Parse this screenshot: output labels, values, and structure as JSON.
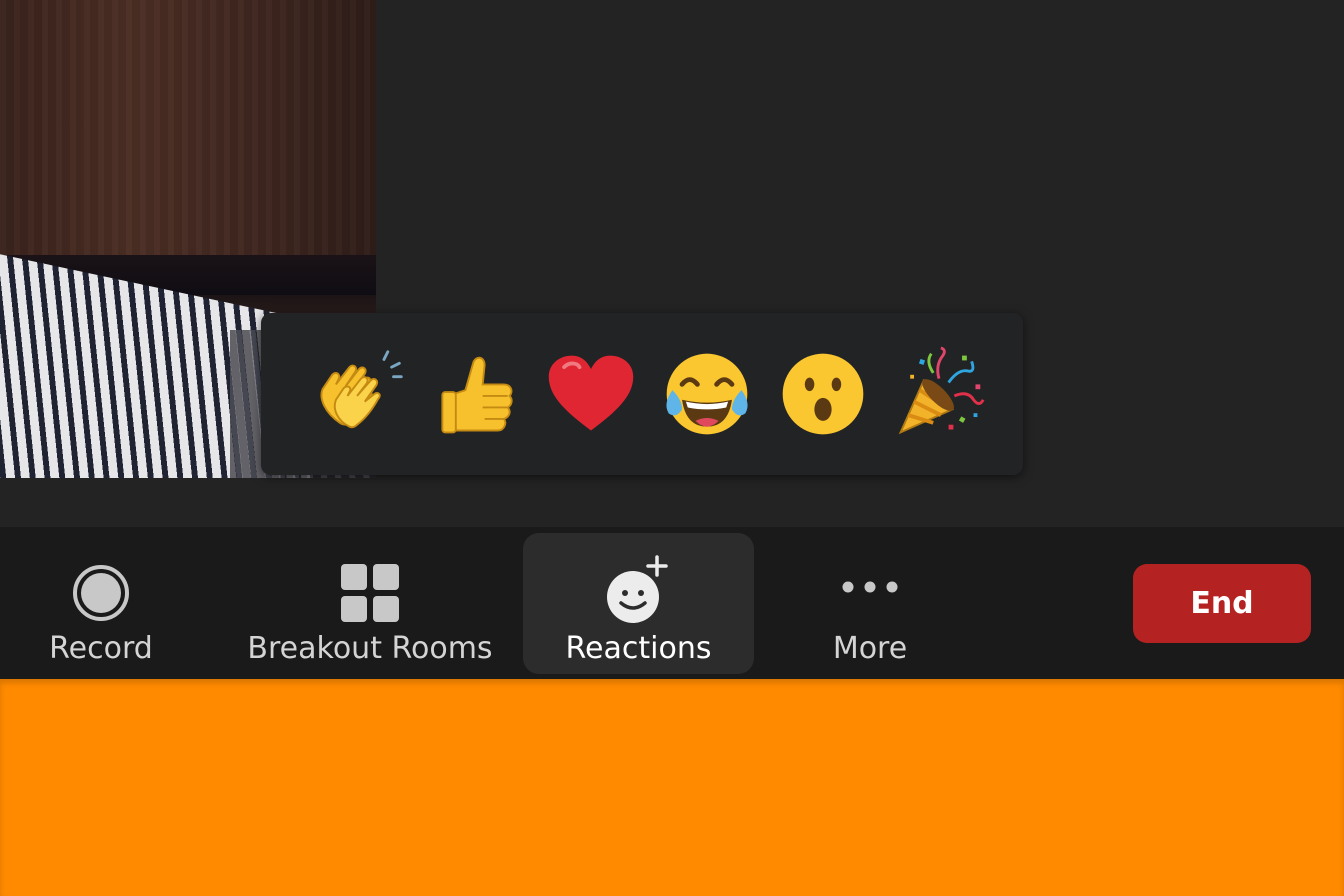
{
  "reactions": [
    {
      "name": "clapping-hands",
      "glyph": "👏"
    },
    {
      "name": "thumbs-up",
      "glyph": "👍"
    },
    {
      "name": "red-heart",
      "glyph": "❤"
    },
    {
      "name": "tears-of-joy",
      "glyph": "😂"
    },
    {
      "name": "open-mouth",
      "glyph": "😮"
    },
    {
      "name": "party-popper",
      "glyph": "🎉"
    }
  ],
  "toolbar": {
    "record_label": "Record",
    "breakout_label": "Breakout Rooms",
    "reactions_label": "Reactions",
    "more_label": "More",
    "end_label": "End"
  },
  "colors": {
    "end_button": "#b52222",
    "accent_bar": "#ff8a00",
    "toolbar_bg": "#1a1a1a",
    "active_item_bg": "#2c2c2c"
  }
}
